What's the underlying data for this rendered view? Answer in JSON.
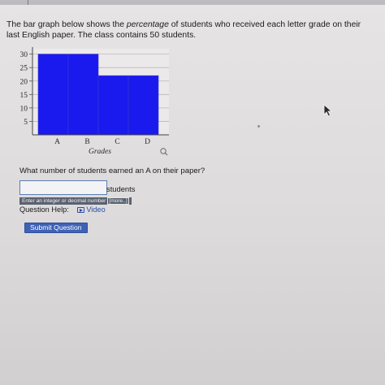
{
  "problem": {
    "text_before": "The bar graph below shows the ",
    "text_emphasis": "percentage",
    "text_after": " of students who received each letter grade on their last English paper. The class contains 50 students."
  },
  "chart_data": {
    "type": "bar",
    "categories": [
      "A",
      "B",
      "C",
      "D"
    ],
    "values": [
      30,
      30,
      22,
      22
    ],
    "xlabel": "Grades",
    "ylabel": "",
    "yticks": [
      5,
      10,
      15,
      20,
      25,
      30
    ],
    "ylim": [
      0,
      32
    ],
    "grid": true,
    "bar_color": "#1a1aee"
  },
  "question": {
    "text": "What number of students earned an A on their paper?"
  },
  "answer": {
    "value": "",
    "unit": "students",
    "hint": "Enter an integer or decimal number",
    "more_label": "[more..]"
  },
  "help": {
    "label": "Question Help:",
    "video_label": "Video"
  },
  "submit_label": "Submit Question",
  "icons": {
    "magnifier": "magnifier-icon",
    "cursor": "mouse-cursor-icon",
    "video": "play-icon"
  },
  "colors": {
    "accent": "#3f62b5",
    "link": "#2a4fa6",
    "bar": "#1a1aee"
  }
}
